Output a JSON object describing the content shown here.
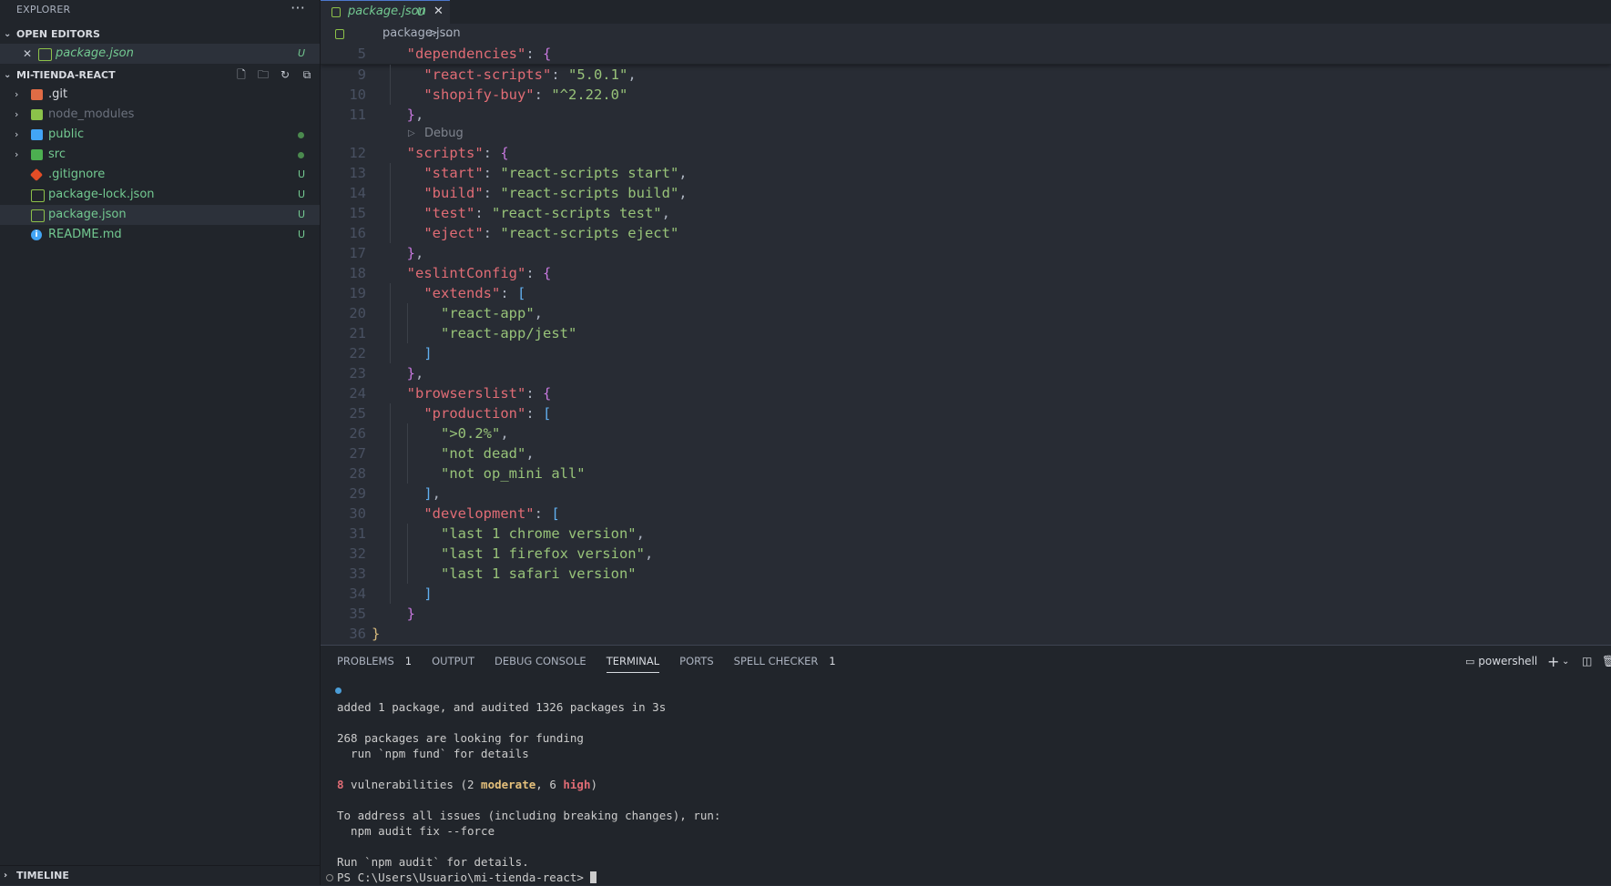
{
  "sidebar": {
    "title": "EXPLORER",
    "more": "···",
    "open_editors": {
      "label": "OPEN EDITORS",
      "items": [
        {
          "name": "package.json",
          "badge": "U"
        }
      ]
    },
    "project": {
      "label": "MI-TIENDA-REACT",
      "items": [
        {
          "name": ".git",
          "badge": ""
        },
        {
          "name": "node_modules",
          "badge": ""
        },
        {
          "name": "public",
          "badge": ""
        },
        {
          "name": "src",
          "badge": ""
        },
        {
          "name": ".gitignore",
          "badge": "U"
        },
        {
          "name": "package-lock.json",
          "badge": "U"
        },
        {
          "name": "package.json",
          "badge": "U"
        },
        {
          "name": "README.md",
          "badge": "U"
        }
      ]
    },
    "timeline": "TIMELINE"
  },
  "editor": {
    "tab": {
      "label": "package.json",
      "badge": "U"
    },
    "breadcrumb": {
      "file": "package.json",
      "sep": "> ..."
    },
    "codelens": "Debug",
    "line_numbers": [
      "5",
      "9",
      "10",
      "11",
      "12",
      "13",
      "14",
      "15",
      "16",
      "17",
      "18",
      "19",
      "20",
      "21",
      "22",
      "23",
      "24",
      "25",
      "26",
      "27",
      "28",
      "29",
      "30",
      "31",
      "32",
      "33",
      "34",
      "35",
      "36"
    ]
  },
  "panel": {
    "tabs": [
      {
        "label": "PROBLEMS",
        "count": "1"
      },
      {
        "label": "OUTPUT",
        "count": ""
      },
      {
        "label": "DEBUG CONSOLE",
        "count": ""
      },
      {
        "label": "TERMINAL",
        "count": ""
      },
      {
        "label": "PORTS",
        "count": ""
      },
      {
        "label": "SPELL CHECKER",
        "count": "1"
      }
    ],
    "shell": "powershell",
    "terminal": {
      "l1": "added 1 package, and audited 1326 packages in 3s",
      "l2": "268 packages are looking for funding",
      "l3": "  run `npm fund` for details",
      "vuln_count": "8",
      "vuln_pre": " vulnerabilities (2 ",
      "vuln_moderate": "moderate",
      "vuln_mid": ", 6 ",
      "vuln_high": "high",
      "vuln_post": ")",
      "l5": "To address all issues (including breaking changes), run:",
      "l6": "  npm audit fix --force",
      "l7": "Run `npm audit` for details.",
      "prompt": "PS C:\\Users\\Usuario\\mi-tienda-react> "
    }
  }
}
